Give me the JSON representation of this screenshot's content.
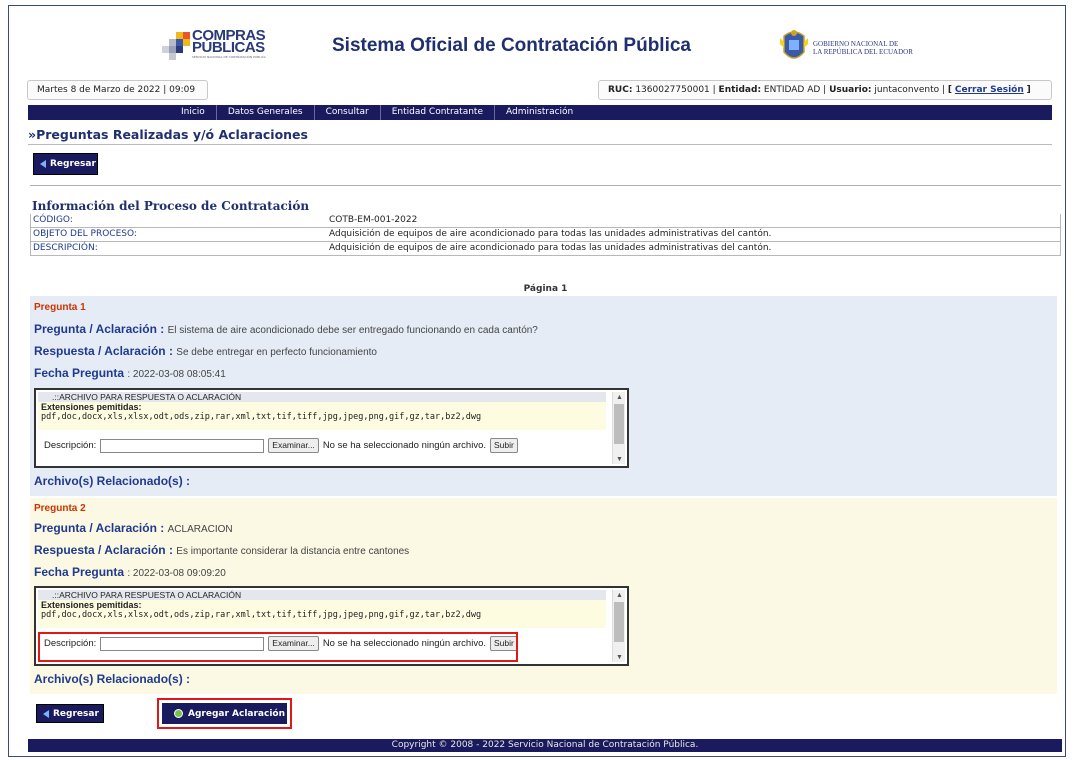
{
  "header": {
    "logo_text_line1": "COMPRAS",
    "logo_text_line2": "PÚBLICAS",
    "logo_subtext": "SERVICIO NACIONAL DE CONTRATACIÓN PÚBLICA",
    "title": "Sistema Oficial de Contratación Pública",
    "gob_line1": "GOBIERNO NACIONAL DE",
    "gob_line2": "LA REPÚBLICA DEL ECUADOR"
  },
  "infobar": {
    "date": "Martes 8 de Marzo de 2022 | 09:09",
    "ruc_label": "RUC:",
    "ruc_value": "1360027750001",
    "entidad_label": "Entidad:",
    "entidad_value": "ENTIDAD AD",
    "usuario_label": "Usuario:",
    "usuario_value": "juntaconvento",
    "logout": "Cerrar Sesión"
  },
  "nav": [
    "Inicio",
    "Datos Generales",
    "Consultar",
    "Entidad Contratante",
    "Administración"
  ],
  "page_heading": "»Preguntas Realizadas y/ó Aclaraciones",
  "buttons": {
    "regresar": "Regresar",
    "agregar": "Agregar Aclaración"
  },
  "process": {
    "title": "Información del Proceso de Contratación",
    "rows": [
      {
        "key": "CÓDIGO:",
        "value": "COTB-EM-001-2022"
      },
      {
        "key": "OBJETO DEL PROCESO:",
        "value": "Adquisición de equipos de aire acondicionado para todas las unidades administrativas del cantón."
      },
      {
        "key": "DESCRIPCIÓN:",
        "value": "Adquisición de equipos de aire acondicionado para todas las unidades administrativas del cantón."
      }
    ]
  },
  "pagina": "Página 1",
  "labels": {
    "pregunta": "Pregunta / Aclaración :",
    "respuesta": "Respuesta / Aclaración :",
    "fecha": "Fecha Pregunta",
    "archivos": "Archivo(s) Relacionado(s) :",
    "upload_title": ".::ARCHIVO PARA RESPUESTA O ACLARACIÓN",
    "extensiones": "Extensiones pemitidas:",
    "ext_list": "pdf,doc,docx,xls,xlsx,odt,ods,zip,rar,xml,txt,tif,tiff,jpg,jpeg,png,gif,gz,tar,bz2,dwg",
    "descripcion": "Descripción:",
    "examinar": "Examinar...",
    "no_file": "No se ha seleccionado ningún archivo.",
    "subir": "Subir"
  },
  "questions": [
    {
      "number": "Pregunta 1",
      "pregunta": "El sistema de aire acondicionado debe ser entregado funcionando en cada cantón?",
      "respuesta": "Se debe entregar en perfecto funcionamiento",
      "fecha": ": 2022-03-08 08:05:41"
    },
    {
      "number": "Pregunta 2",
      "pregunta": "ACLARACION",
      "respuesta": "Es importante considerar la distancia entre cantones",
      "fecha": ": 2022-03-08 09:09:20"
    }
  ],
  "footer": "Copyright © 2008 - 2022 Servicio Nacional de Contratación Pública.",
  "colors": {
    "nav_bg": "#1a1a5e",
    "heading": "#1f2f6f",
    "question_number": "#cc3300",
    "highlight": "#e01818",
    "q1_bg": "#e6ecf6",
    "q2_bg": "#fbf8e3"
  }
}
